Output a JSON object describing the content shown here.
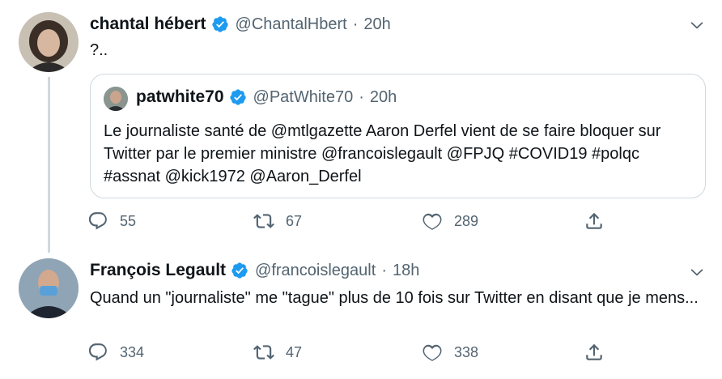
{
  "tweets": [
    {
      "name": "chantal hébert",
      "handle": "@ChantalHbert",
      "dot": "·",
      "time": "20h",
      "text": "?..",
      "actions": {
        "reply": "55",
        "retweet": "67",
        "like": "289"
      },
      "quote": {
        "name": "patwhite70",
        "handle": "@PatWhite70",
        "dot": "·",
        "time": "20h",
        "text": "Le journaliste santé de @mtlgazette Aaron Derfel vient de se faire bloquer sur Twitter par le premier ministre @francoislegault @FPJQ #COVID19 #polqc #assnat @kick1972 @Aaron_Derfel"
      }
    },
    {
      "name": "François Legault",
      "handle": "@francoislegault",
      "dot": "·",
      "time": "18h",
      "text": "Quand un \"journaliste\" me \"tague\" plus de 10 fois sur Twitter en disant que je mens...",
      "actions": {
        "reply": "334",
        "retweet": "47",
        "like": "338"
      }
    }
  ],
  "colors": {
    "text": "#0f1419",
    "secondary": "#536471",
    "verified": "#1d9bf0",
    "border": "#cfd9de"
  },
  "icons": [
    "verified-badge-icon",
    "chevron-down-icon",
    "reply-icon",
    "retweet-icon",
    "like-icon",
    "share-icon"
  ]
}
